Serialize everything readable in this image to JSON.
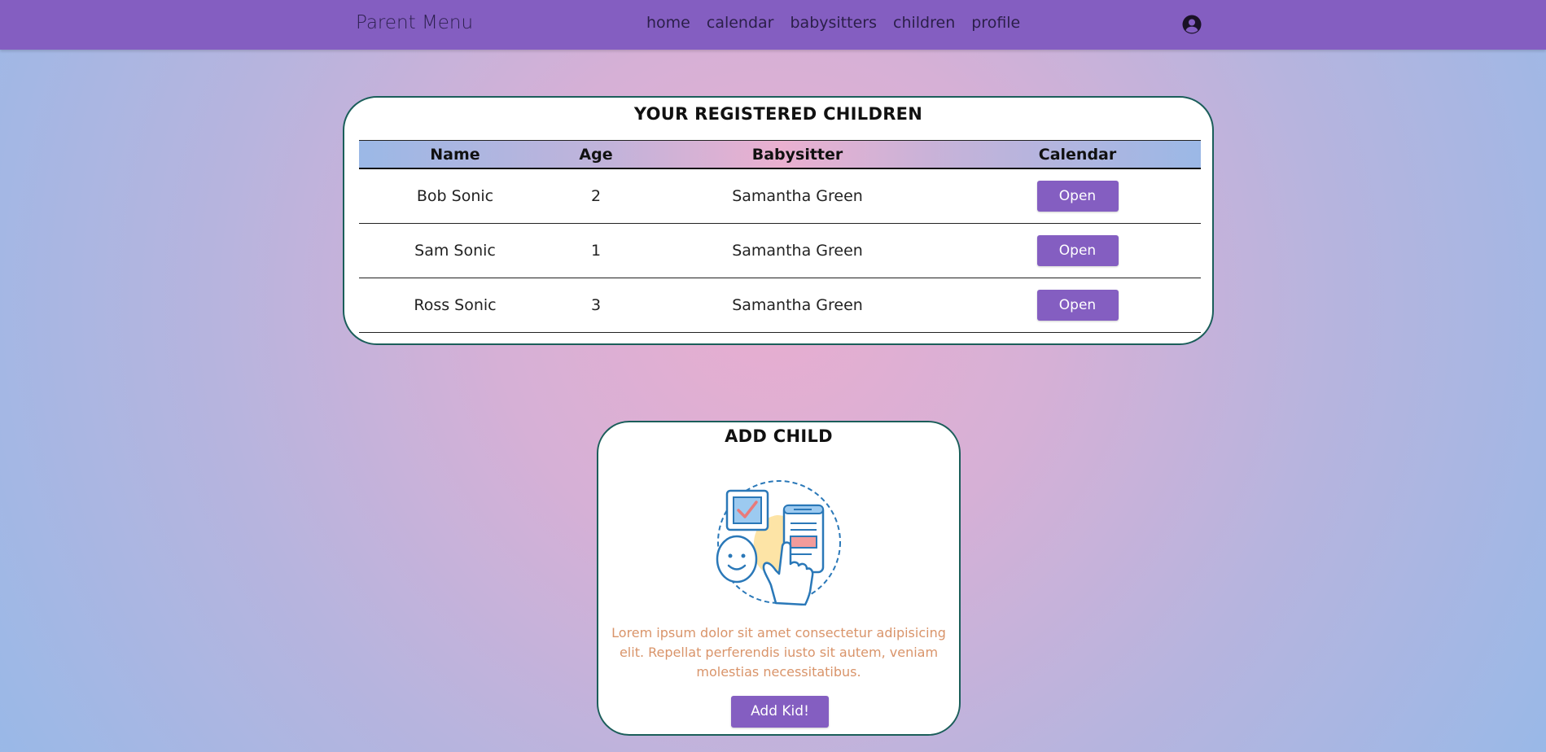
{
  "nav": {
    "brand": "Parent Menu",
    "links": [
      "home",
      "calendar",
      "babysitters",
      "children",
      "profile"
    ],
    "user_icon": "user-circle-icon"
  },
  "children_card": {
    "title": "YOUR REGISTERED CHILDREN",
    "headers": [
      "Name",
      "Age",
      "Babysitter",
      "Calendar"
    ],
    "rows": [
      {
        "name": "Bob Sonic",
        "age": "2",
        "babysitter": "Samantha Green",
        "action": "Open"
      },
      {
        "name": "Sam Sonic",
        "age": "1",
        "babysitter": "Samantha Green",
        "action": "Open"
      },
      {
        "name": "Ross Sonic",
        "age": "3",
        "babysitter": "Samantha Green",
        "action": "Open"
      }
    ]
  },
  "add_card": {
    "title": "ADD CHILD",
    "illustration": "child-registration-illustration",
    "description": "Lorem ipsum dolor sit amet consectetur adipisicing elit. Repellat perferendis iusto sit autem, veniam molestias necessitatibus.",
    "button": "Add Kid!"
  },
  "colors": {
    "nav": "#845ec1",
    "button": "#845ec1",
    "card_border": "#1b5e5a",
    "description_text": "#d9946a"
  }
}
